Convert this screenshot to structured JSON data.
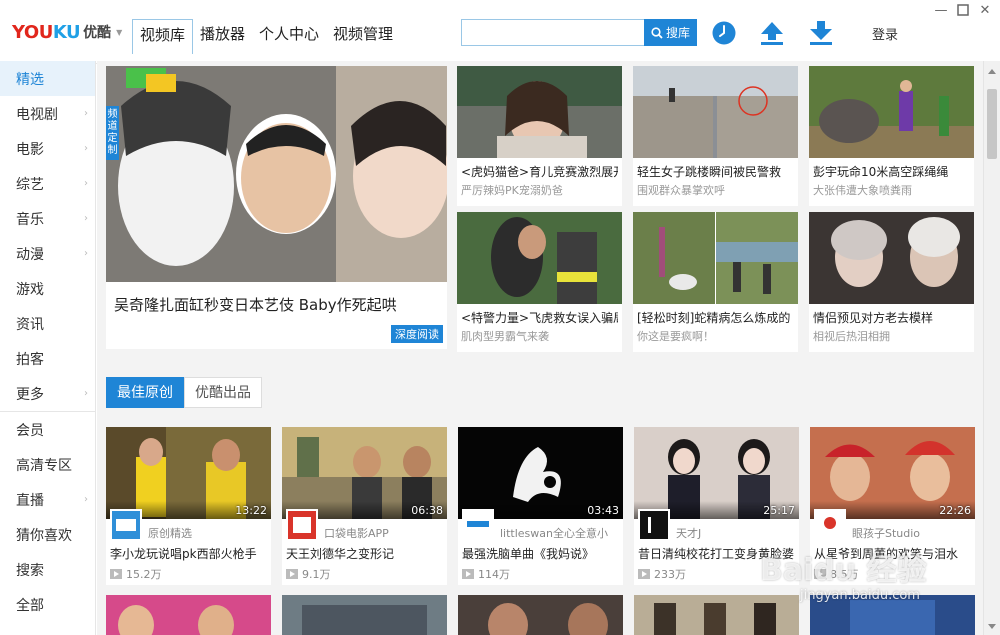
{
  "app": {
    "logo_en_a": "YOU",
    "logo_en_b": "KU",
    "logo_cn": "优酷"
  },
  "nav": {
    "tabs": [
      {
        "label": "视频库"
      },
      {
        "label": "播放器"
      },
      {
        "label": "个人中心"
      },
      {
        "label": "视频管理"
      }
    ]
  },
  "search": {
    "value": "",
    "button_label": "搜库"
  },
  "login_label": "登录",
  "sidebar": {
    "items": [
      {
        "label": "精选"
      },
      {
        "label": "电视剧"
      },
      {
        "label": "电影"
      },
      {
        "label": "综艺"
      },
      {
        "label": "音乐"
      },
      {
        "label": "动漫"
      },
      {
        "label": "游戏"
      },
      {
        "label": "资讯"
      },
      {
        "label": "拍客"
      },
      {
        "label": "更多"
      },
      {
        "label": "会员"
      },
      {
        "label": "高清专区"
      },
      {
        "label": "直播"
      },
      {
        "label": "猜你喜欢"
      },
      {
        "label": "搜索"
      },
      {
        "label": "全部"
      }
    ]
  },
  "featured": {
    "side_tag": "频道定制",
    "title": "吴奇隆扎面缸秒变日本艺伎 Baby作死起哄",
    "badge": "深度阅读"
  },
  "grid": [
    {
      "title": "<虎妈猫爸>育儿竞赛激烈展开",
      "sub": "严厉辣妈PK宠溺奶爸"
    },
    {
      "title": "轻生女子跳楼瞬间被民警救",
      "sub": "围观群众暴掌欢呼"
    },
    {
      "title": "彭宇玩命10米高空踩绳绳",
      "sub": "大张伟遭大象喷粪雨"
    },
    {
      "title": "<特警力量>飞虎救女误入骗局",
      "sub": "肌肉型男霸气来袭"
    },
    {
      "title": "[轻松时刻]蛇精病怎么炼成的",
      "sub": "你这是要疯啊！"
    },
    {
      "title": "情侣预见对方老去模样",
      "sub": "相视后热泪相拥"
    }
  ],
  "section_tabs": [
    {
      "label": "最佳原创"
    },
    {
      "label": "优酷出品"
    }
  ],
  "videos": [
    {
      "duration": "13:22",
      "channel": "原创精选",
      "title": "李小龙玩说唱pk西部火枪手",
      "views": "15.2万"
    },
    {
      "duration": "06:38",
      "channel": "口袋电影APP",
      "title": "天王刘德华之变形记",
      "views": "9.1万"
    },
    {
      "duration": "03:43",
      "channel": "littleswan全心全意小",
      "title": "最强洗脑单曲《我妈说》",
      "views": "114万"
    },
    {
      "duration": "25:17",
      "channel": "天才J",
      "title": "昔日清纯校花打工变身黄脸婆",
      "views": "233万"
    },
    {
      "duration": "22:26",
      "channel": "眼孩子Studio",
      "title": "从星爷到周董的欢笑与泪水",
      "views": "8.5万"
    }
  ],
  "watermark": {
    "text": "Baidu 经验",
    "url": "jingyan.baidu.com"
  }
}
